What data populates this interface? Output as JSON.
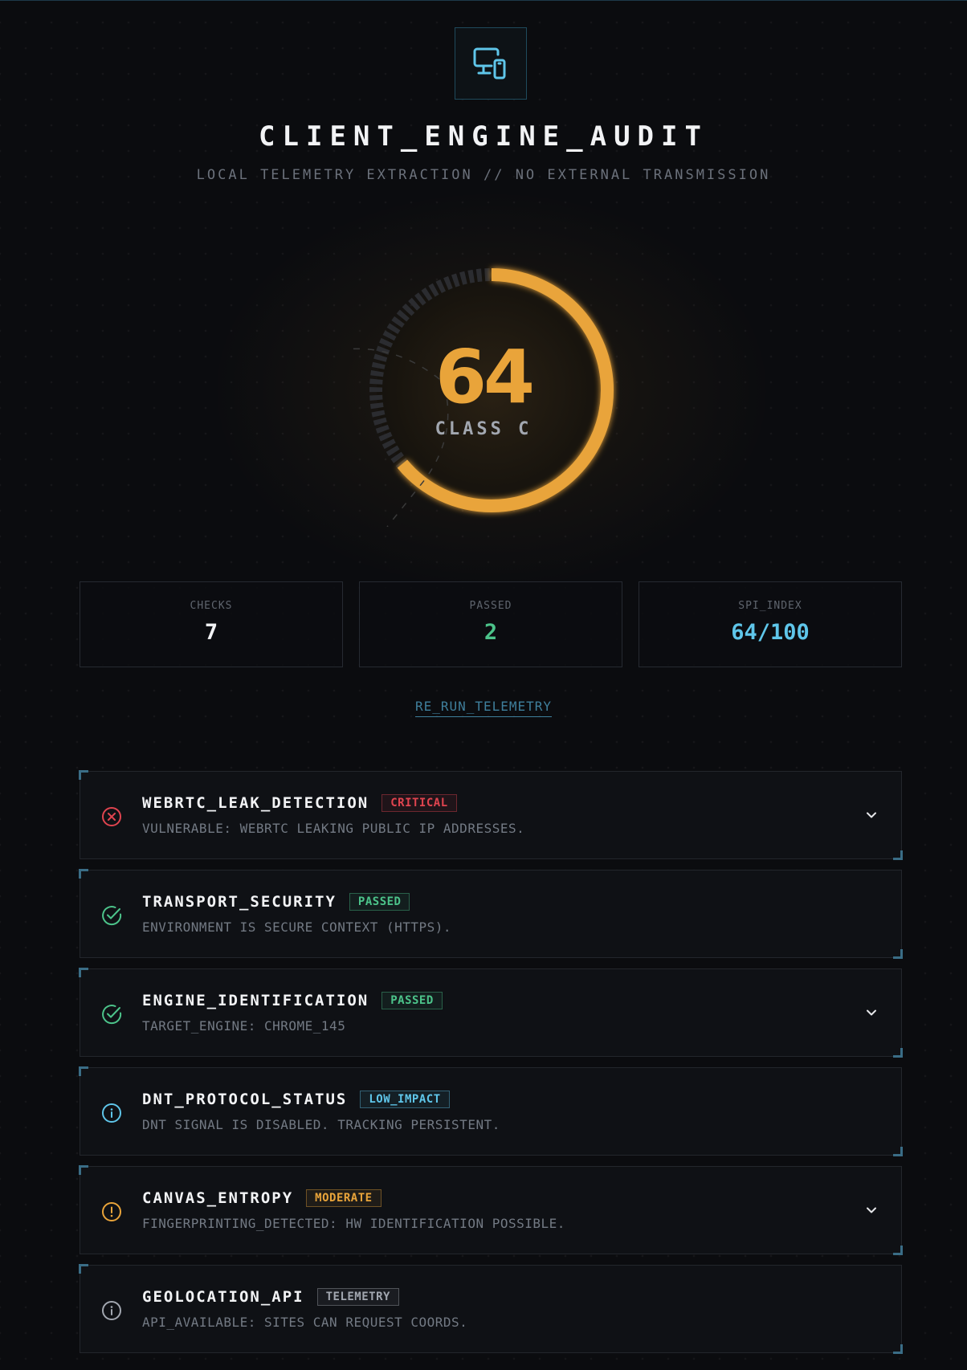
{
  "header": {
    "title": "CLIENT_ENGINE_AUDIT",
    "subtitle": "LOCAL TELEMETRY EXTRACTION // NO EXTERNAL TRANSMISSION",
    "logo_icon": "devices-icon"
  },
  "score": {
    "value": "64",
    "fraction": 0.64,
    "class_label": "CLASS C",
    "accent_color": "#e9a43a"
  },
  "stats": [
    {
      "label": "CHECKS",
      "value": "7",
      "color": "#f2f3f5"
    },
    {
      "label": "PASSED",
      "value": "2",
      "color": "#4cc38a"
    },
    {
      "label": "SPI_INDEX",
      "value": "64/100",
      "color": "#5fc6ea"
    }
  ],
  "actions": {
    "rerun_label": "RE_RUN_TELEMETRY"
  },
  "checks": [
    {
      "name": "WEBRTC_LEAK_DETECTION",
      "badge": "CRITICAL",
      "badge_color": "#e0444f",
      "description": "VULNERABLE: WEBRTC LEAKING PUBLIC IP ADDRESSES.",
      "icon": "x-circle-icon",
      "expandable": true
    },
    {
      "name": "TRANSPORT_SECURITY",
      "badge": "PASSED",
      "badge_color": "#4cc38a",
      "description": "ENVIRONMENT IS SECURE CONTEXT (HTTPS).",
      "icon": "check-circle-icon",
      "expandable": false
    },
    {
      "name": "ENGINE_IDENTIFICATION",
      "badge": "PASSED",
      "badge_color": "#4cc38a",
      "description": "TARGET_ENGINE: CHROME_145",
      "icon": "check-circle-icon",
      "expandable": true
    },
    {
      "name": "DNT_PROTOCOL_STATUS",
      "badge": "LOW_IMPACT",
      "badge_color": "#5fc6ea",
      "description": "DNT SIGNAL IS DISABLED. TRACKING PERSISTENT.",
      "icon": "info-circle-icon",
      "expandable": false
    },
    {
      "name": "CANVAS_ENTROPY",
      "badge": "MODERATE",
      "badge_color": "#e9a43a",
      "description": "FINGERPRINTING_DETECTED: HW IDENTIFICATION POSSIBLE.",
      "icon": "alert-circle-icon",
      "expandable": true
    },
    {
      "name": "GEOLOCATION_API",
      "badge": "TELEMETRY",
      "badge_color": "#a2a7b0",
      "description": "API_AVAILABLE: SITES CAN REQUEST COORDS.",
      "icon": "info-circle-icon",
      "expandable": false
    }
  ]
}
